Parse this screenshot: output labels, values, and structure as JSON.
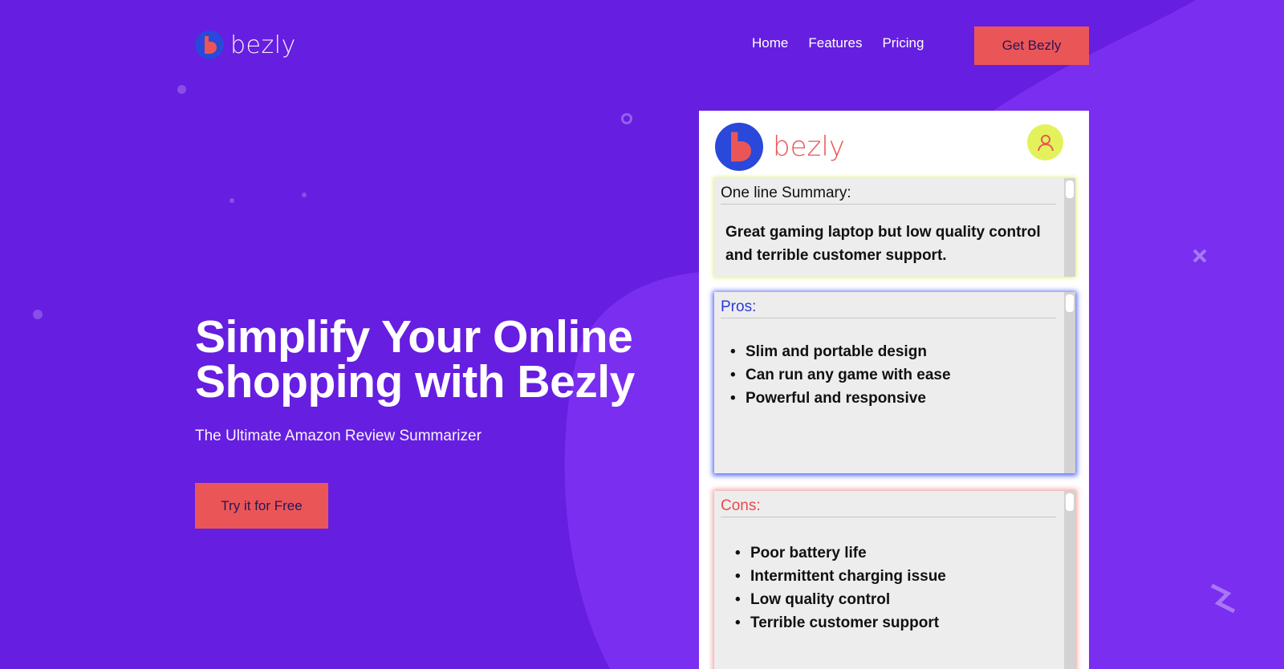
{
  "brand": {
    "name": "bezly",
    "colors": {
      "background": "#661ee0",
      "accent": "#ea5657",
      "pros": "#2a3bd9",
      "avatar": "#e3f25b"
    }
  },
  "nav": {
    "items": [
      "Home",
      "Features",
      "Pricing"
    ],
    "cta": "Get Bezly"
  },
  "hero": {
    "title_line1": "Simplify Your Online",
    "title_line2": "Shopping with Bezly",
    "subtitle": "The Ultimate Amazon Review Summarizer",
    "cta": "Try it for Free"
  },
  "mockup": {
    "logo_text": "bezly",
    "avatar_icon": "user-icon",
    "summary": {
      "title": "One line Summary:",
      "text": "Great gaming laptop but low quality control and terrible customer support."
    },
    "pros": {
      "title": "Pros:",
      "items": [
        "Slim and portable design",
        "Can run any game with ease",
        "Powerful and responsive"
      ]
    },
    "cons": {
      "title": "Cons:",
      "items": [
        "Poor battery life",
        "Intermittent charging issue",
        "Low quality control",
        "Terrible customer support"
      ]
    }
  }
}
